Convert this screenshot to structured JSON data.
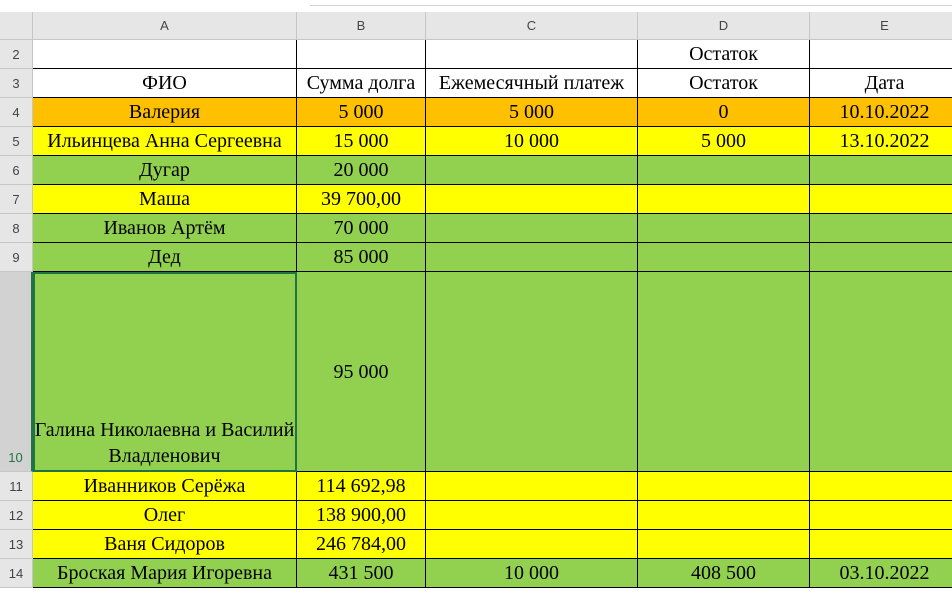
{
  "columns": [
    "A",
    "B",
    "C",
    "D",
    "E"
  ],
  "rows": [
    {
      "num": "2",
      "color": "white",
      "cells": [
        "",
        "",
        "",
        "Остаток",
        ""
      ]
    },
    {
      "num": "3",
      "color": "white",
      "cells": [
        "ФИО",
        "Сумма долга",
        "Ежемесячный платеж",
        "Остаток",
        "Дата"
      ]
    },
    {
      "num": "4",
      "color": "orange",
      "cells": [
        "Валерия",
        "5 000",
        "5 000",
        "0",
        "10.10.2022"
      ]
    },
    {
      "num": "5",
      "color": "yellow",
      "cells": [
        "Ильинцева Анна Сергеевна",
        "15 000",
        "10 000",
        "5 000",
        "13.10.2022"
      ]
    },
    {
      "num": "6",
      "color": "green",
      "cells": [
        "Дугар",
        "20 000",
        "",
        "",
        ""
      ]
    },
    {
      "num": "7",
      "color": "yellow",
      "cells": [
        "Маша",
        "39 700,00",
        "",
        "",
        ""
      ]
    },
    {
      "num": "8",
      "color": "green",
      "cells": [
        "Иванов Артём",
        "70 000",
        "",
        "",
        ""
      ]
    },
    {
      "num": "9",
      "color": "green",
      "cells": [
        "Дед",
        "85 000",
        "",
        "",
        ""
      ]
    },
    {
      "num": "10",
      "color": "green",
      "cells": [
        "Галина Николаевна и Василий Владленович",
        "95 000",
        "",
        "",
        ""
      ]
    },
    {
      "num": "11",
      "color": "yellow",
      "cells": [
        "Иванников Серёжа",
        "114 692,98",
        "",
        "",
        ""
      ]
    },
    {
      "num": "12",
      "color": "yellow",
      "cells": [
        "Олег",
        "138 900,00",
        "",
        "",
        ""
      ]
    },
    {
      "num": "13",
      "color": "yellow",
      "cells": [
        "Ваня Сидоров",
        "246 784,00",
        "",
        "",
        ""
      ]
    },
    {
      "num": "14",
      "color": "green",
      "cells": [
        "Броская Мария Игоревна",
        "431 500",
        "10 000",
        "408 500",
        "03.10.2022"
      ]
    }
  ]
}
